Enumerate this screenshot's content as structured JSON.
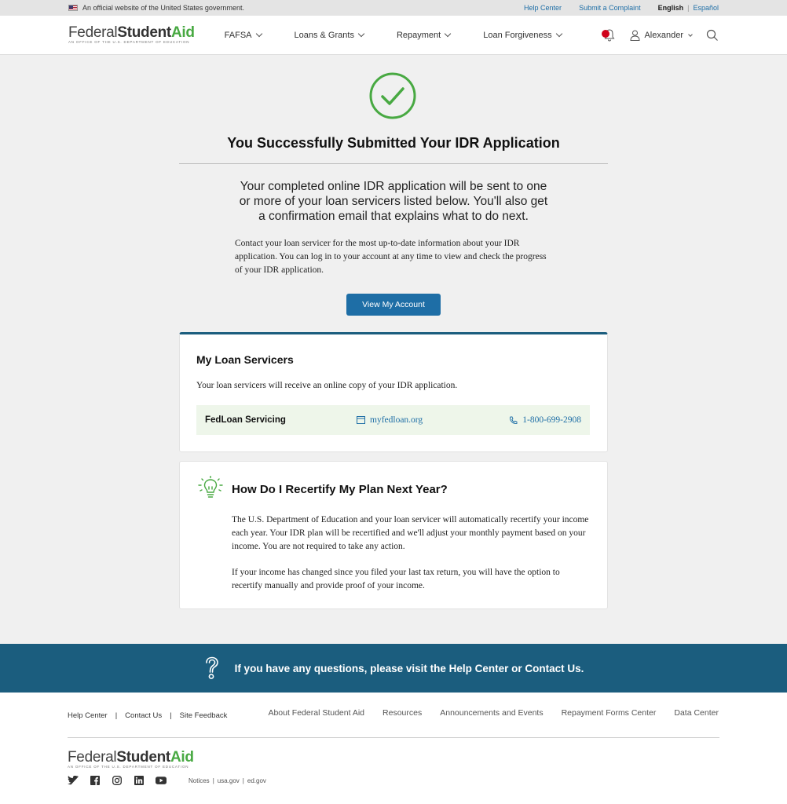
{
  "gov_banner": {
    "text": "An official website of the United States government.",
    "help_center": "Help Center",
    "submit_complaint": "Submit a Complaint",
    "lang_english": "English",
    "lang_sep": "|",
    "lang_espanol": "Español"
  },
  "header": {
    "logo_federal": "Federal",
    "logo_student": "Student",
    "logo_aid": "Aid",
    "logo_tagline": "An OFFICE of the U.S. DEPARTMENT of EDUCATION",
    "nav": [
      {
        "label": "FAFSA"
      },
      {
        "label": "Loans & Grants"
      },
      {
        "label": "Repayment"
      },
      {
        "label": "Loan Forgiveness"
      }
    ],
    "user_name": "Alexander"
  },
  "main": {
    "title": "You Successfully Submitted Your IDR Application",
    "lead": "Your completed online IDR application will be sent to one or more of your loan servicers listed below. You'll also get a confirmation email that explains what to do next.",
    "body": "Contact your loan servicer for the most up-to-date information about your IDR application. You can log in to your account at any time to view and check the progress of your IDR application.",
    "view_account_button": "View My Account"
  },
  "servicers_card": {
    "title": "My Loan Servicers",
    "description": "Your loan servicers will receive an online copy of your IDR application.",
    "servicers": [
      {
        "name": "FedLoan Servicing",
        "website": "myfedloan.org",
        "phone": "1-800-699-2908"
      }
    ]
  },
  "recertify_card": {
    "title": "How Do I Recertify My Plan Next Year?",
    "para1": "The U.S. Department of Education and your loan servicer will automatically recertify your income each year. Your IDR plan will be recertified and we'll adjust your monthly payment based on your income. You are not required to take any action.",
    "para2": "If your income has changed since you filed your last tax return, you will have the option to recertify manually and provide proof of your income."
  },
  "help_band": {
    "text": "If you have any questions, please visit the Help Center or Contact Us."
  },
  "footer": {
    "left_links": [
      {
        "label": "Help Center"
      },
      {
        "label": "Contact Us"
      },
      {
        "label": "Site Feedback"
      }
    ],
    "link_sep": "|",
    "right_links": [
      {
        "label": "About Federal Student Aid"
      },
      {
        "label": "Resources"
      },
      {
        "label": "Announcements and Events"
      },
      {
        "label": "Repayment Forms Center"
      },
      {
        "label": "Data Center"
      }
    ],
    "legal_links": [
      {
        "label": "Notices"
      },
      {
        "label": "usa.gov"
      },
      {
        "label": "ed.gov"
      }
    ]
  },
  "colors": {
    "accent_blue": "#1e6ea6",
    "brand_green": "#48a942",
    "band_blue": "#1b5d7e",
    "notification_red": "#d0021b"
  },
  "icons": [
    "us-flag-icon",
    "notification-bell-icon",
    "user-icon",
    "search-icon",
    "check-circle-icon",
    "website-icon",
    "phone-icon",
    "lightbulb-icon",
    "question-icon",
    "twitter-icon",
    "facebook-icon",
    "instagram-icon",
    "linkedin-icon",
    "youtube-icon"
  ]
}
